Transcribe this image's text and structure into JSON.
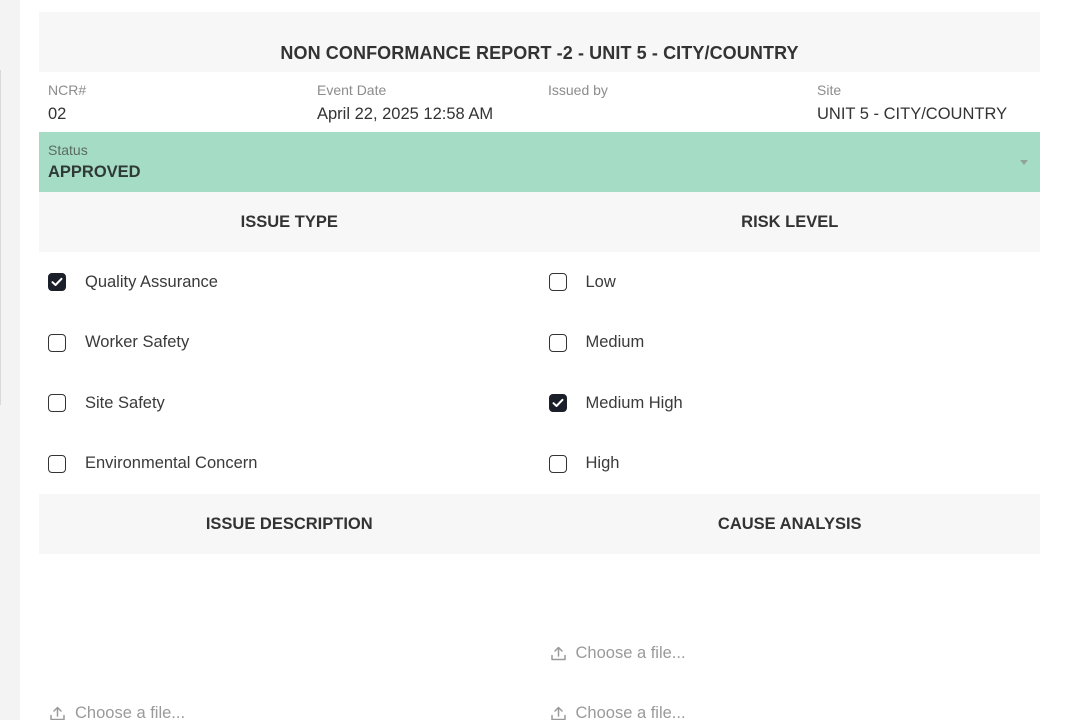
{
  "report": {
    "title": "NON CONFORMANCE REPORT -2 - UNIT 5 - CITY/COUNTRY"
  },
  "meta": {
    "ncr_label": "NCR#",
    "ncr_value": "02",
    "event_date_label": "Event Date",
    "event_date_value": "April 22, 2025 12:58 AM",
    "issued_by_label": "Issued by",
    "issued_by_value": "",
    "site_label": "Site",
    "site_value": "UNIT 5 - CITY/COUNTRY"
  },
  "status": {
    "label": "Status",
    "value": "APPROVED",
    "color": "#a5dcc6"
  },
  "issue_type": {
    "heading": "ISSUE TYPE",
    "options": [
      {
        "label": "Quality Assurance",
        "checked": true
      },
      {
        "label": "Worker Safety",
        "checked": false
      },
      {
        "label": "Site Safety",
        "checked": false
      },
      {
        "label": "Environmental Concern",
        "checked": false
      }
    ]
  },
  "risk_level": {
    "heading": "RISK LEVEL",
    "options": [
      {
        "label": "Low",
        "checked": false
      },
      {
        "label": "Medium",
        "checked": false
      },
      {
        "label": "Medium High",
        "checked": true
      },
      {
        "label": "High",
        "checked": false
      }
    ]
  },
  "issue_description": {
    "heading": "ISSUE DESCRIPTION",
    "file_picker_1": "Choose a file..."
  },
  "cause_analysis": {
    "heading": "CAUSE ANALYSIS",
    "file_picker_1": "Choose a file...",
    "file_picker_2": "Choose a file..."
  },
  "icons": {
    "checkmark": "check-icon",
    "upload": "upload-icon",
    "dropdown": "caret-down-icon"
  }
}
